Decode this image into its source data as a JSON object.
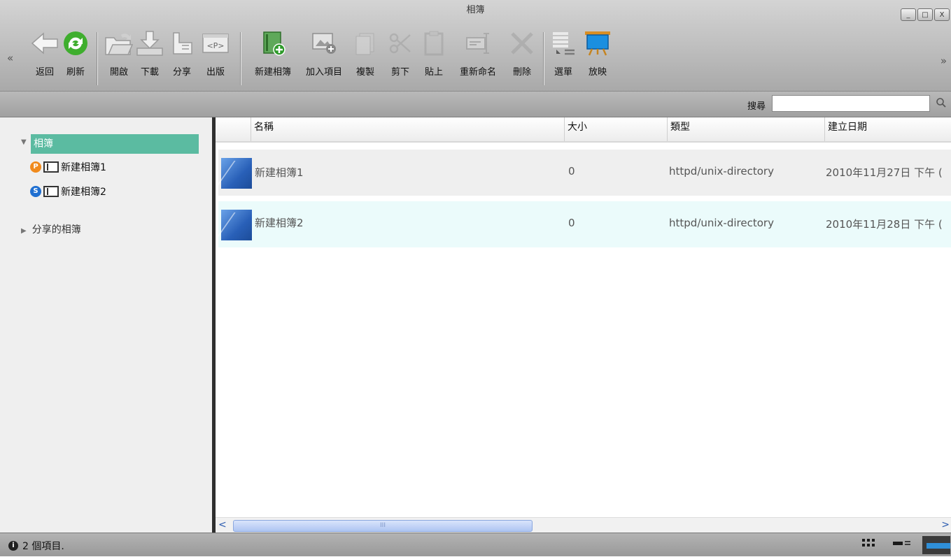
{
  "window": {
    "title": "相簿",
    "controls": {
      "minimize": "_",
      "maximize": "□",
      "close": "X"
    }
  },
  "toolbar": {
    "scroll_left": "«",
    "scroll_right": "»",
    "buttons": [
      {
        "id": "back",
        "label": "返回",
        "icon": "back-arrow-icon"
      },
      {
        "id": "refresh",
        "label": "刷新",
        "icon": "refresh-icon"
      },
      {
        "id": "open",
        "label": "開啟",
        "icon": "folder-open-icon"
      },
      {
        "id": "download",
        "label": "下載",
        "icon": "download-icon"
      },
      {
        "id": "share",
        "label": "分享",
        "icon": "share-hand-icon"
      },
      {
        "id": "publish",
        "label": "出版",
        "icon": "publish-icon",
        "icon_text": "<P>"
      },
      {
        "id": "new-album",
        "label": "新建相簿",
        "icon": "new-album-icon"
      },
      {
        "id": "add-item",
        "label": "加入項目",
        "icon": "add-item-icon"
      },
      {
        "id": "copy",
        "label": "複製",
        "icon": "copy-icon"
      },
      {
        "id": "cut",
        "label": "剪下",
        "icon": "cut-icon"
      },
      {
        "id": "paste",
        "label": "貼上",
        "icon": "paste-icon"
      },
      {
        "id": "rename",
        "label": "重新命名",
        "icon": "rename-icon"
      },
      {
        "id": "delete",
        "label": "刪除",
        "icon": "delete-icon"
      },
      {
        "id": "menu",
        "label": "選單",
        "icon": "menu-icon"
      },
      {
        "id": "slideshow",
        "label": "放映",
        "icon": "slideshow-icon"
      }
    ]
  },
  "search": {
    "label": "搜尋",
    "value": "",
    "placeholder": ""
  },
  "sidebar": {
    "root": {
      "label": "相簿",
      "expanded": true
    },
    "albums": [
      {
        "label": "新建相簿1",
        "badge": "P",
        "badge_color": "#f08a1c"
      },
      {
        "label": "新建相簿2",
        "badge": "S",
        "badge_color": "#1f6fd1"
      }
    ],
    "shared": {
      "label": "分享的相簿",
      "expanded": false
    }
  },
  "list": {
    "columns": [
      "名稱",
      "大小",
      "類型",
      "建立日期"
    ],
    "rows": [
      {
        "name": "新建相簿1",
        "size": "0",
        "type": "httpd/unix-directory",
        "created": "2010年11月27日 下午 (",
        "bg": "#efefef"
      },
      {
        "name": "新建相簿2",
        "size": "0",
        "type": "httpd/unix-directory",
        "created": "2010年11月28日 下午 (",
        "bg": "#ebfbfb"
      }
    ]
  },
  "scrollbar": {
    "left": "<",
    "right": ">",
    "grip": "III"
  },
  "status": {
    "text": "2 個項目."
  },
  "colors": {
    "accent": "#5bbba1",
    "toolbar": "#bdbdbd"
  }
}
